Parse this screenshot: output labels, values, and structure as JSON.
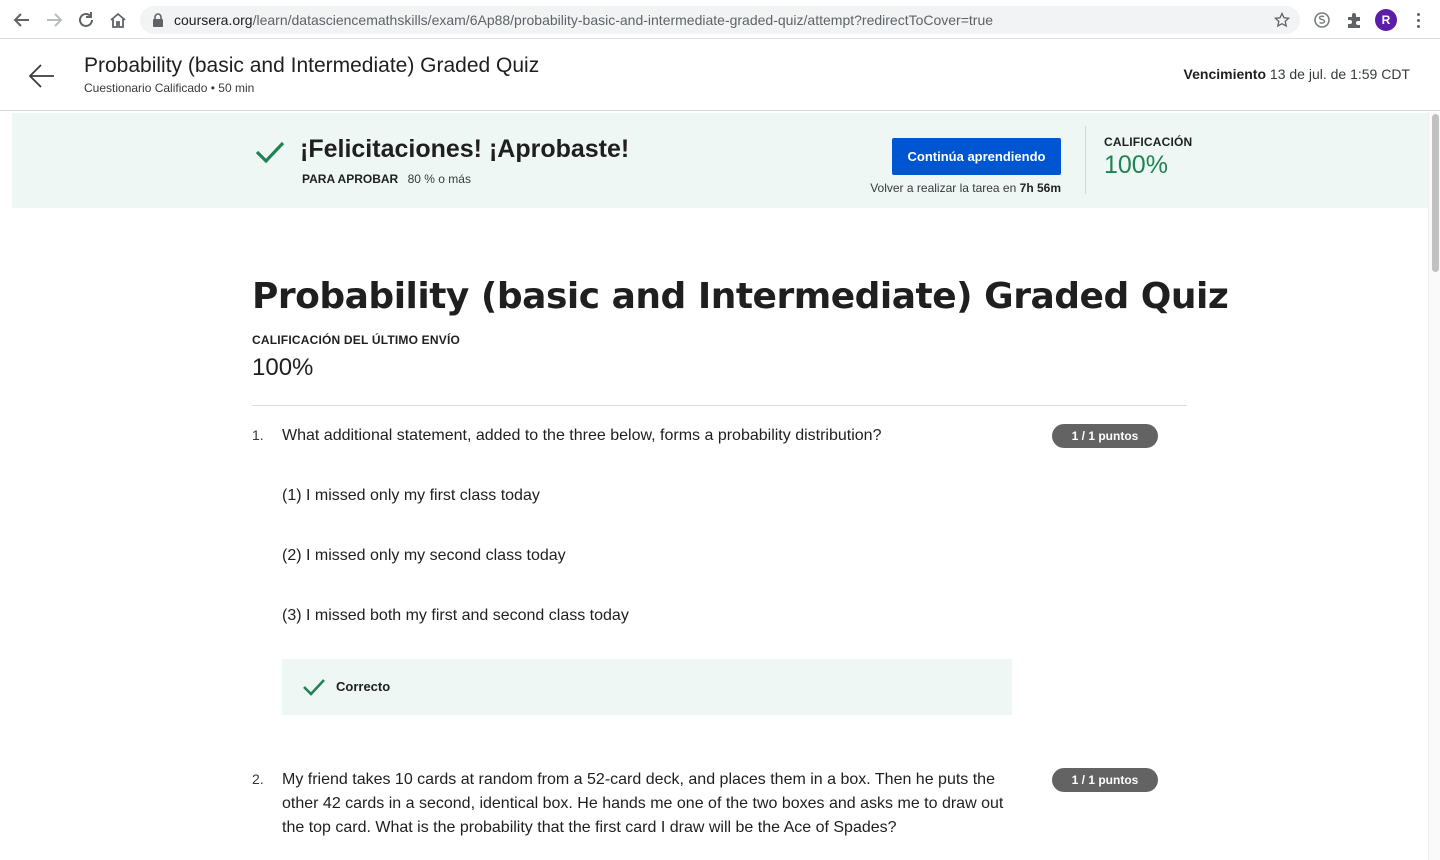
{
  "browser": {
    "url_host": "coursera.org",
    "url_path": "/learn/datasciencemathskills/exam/6Ap88/probability-basic-and-intermediate-graded-quiz/attempt?redirectToCover=true",
    "profile_initial": "R"
  },
  "header": {
    "title": "Probability (basic and Intermediate) Graded Quiz",
    "subtitle": "Cuestionario Calificado • 50 min",
    "due_label": "Vencimiento",
    "due_value": "13 de jul. de 1:59 CDT"
  },
  "banner": {
    "title": "¡Felicitaciones! ¡Aprobaste!",
    "pass_label": "PARA APROBAR",
    "pass_value": "80 % o más",
    "cta_label": "Continúa aprendiendo",
    "retake_prefix": "Volver a realizar la tarea en",
    "retake_time": "7h 56m",
    "grade_label": "CALIFICACIÓN",
    "grade_value": "100%"
  },
  "main": {
    "title": "Probability (basic and Intermediate) Graded Quiz",
    "last_grade_label": "CALIFICACIÓN DEL ÚLTIMO ENVÍO",
    "last_grade_value": "100%"
  },
  "questions": [
    {
      "number": "1.",
      "text": "What additional statement, added to the three below, forms a probability distribution?",
      "points": "1 / 1 puntos",
      "statements": [
        "(1) I missed only my first class today",
        "(2) I missed only my second class today",
        "(3) I missed both my first and second class today"
      ],
      "feedback": "Correcto"
    },
    {
      "number": "2.",
      "text": "My friend takes 10 cards at random from a 52-card deck, and places them in a box. Then he puts the other 42 cards in a second, identical box. He hands me one of the two boxes and asks me to draw out the top card. What is the probability that the first card I draw will be the Ace of Spades?",
      "points": "1 / 1 puntos"
    }
  ],
  "colors": {
    "accent_blue": "#0056d2",
    "success_green": "#1f8354",
    "banner_bg": "#eef7f4",
    "points_badge": "#636363"
  }
}
